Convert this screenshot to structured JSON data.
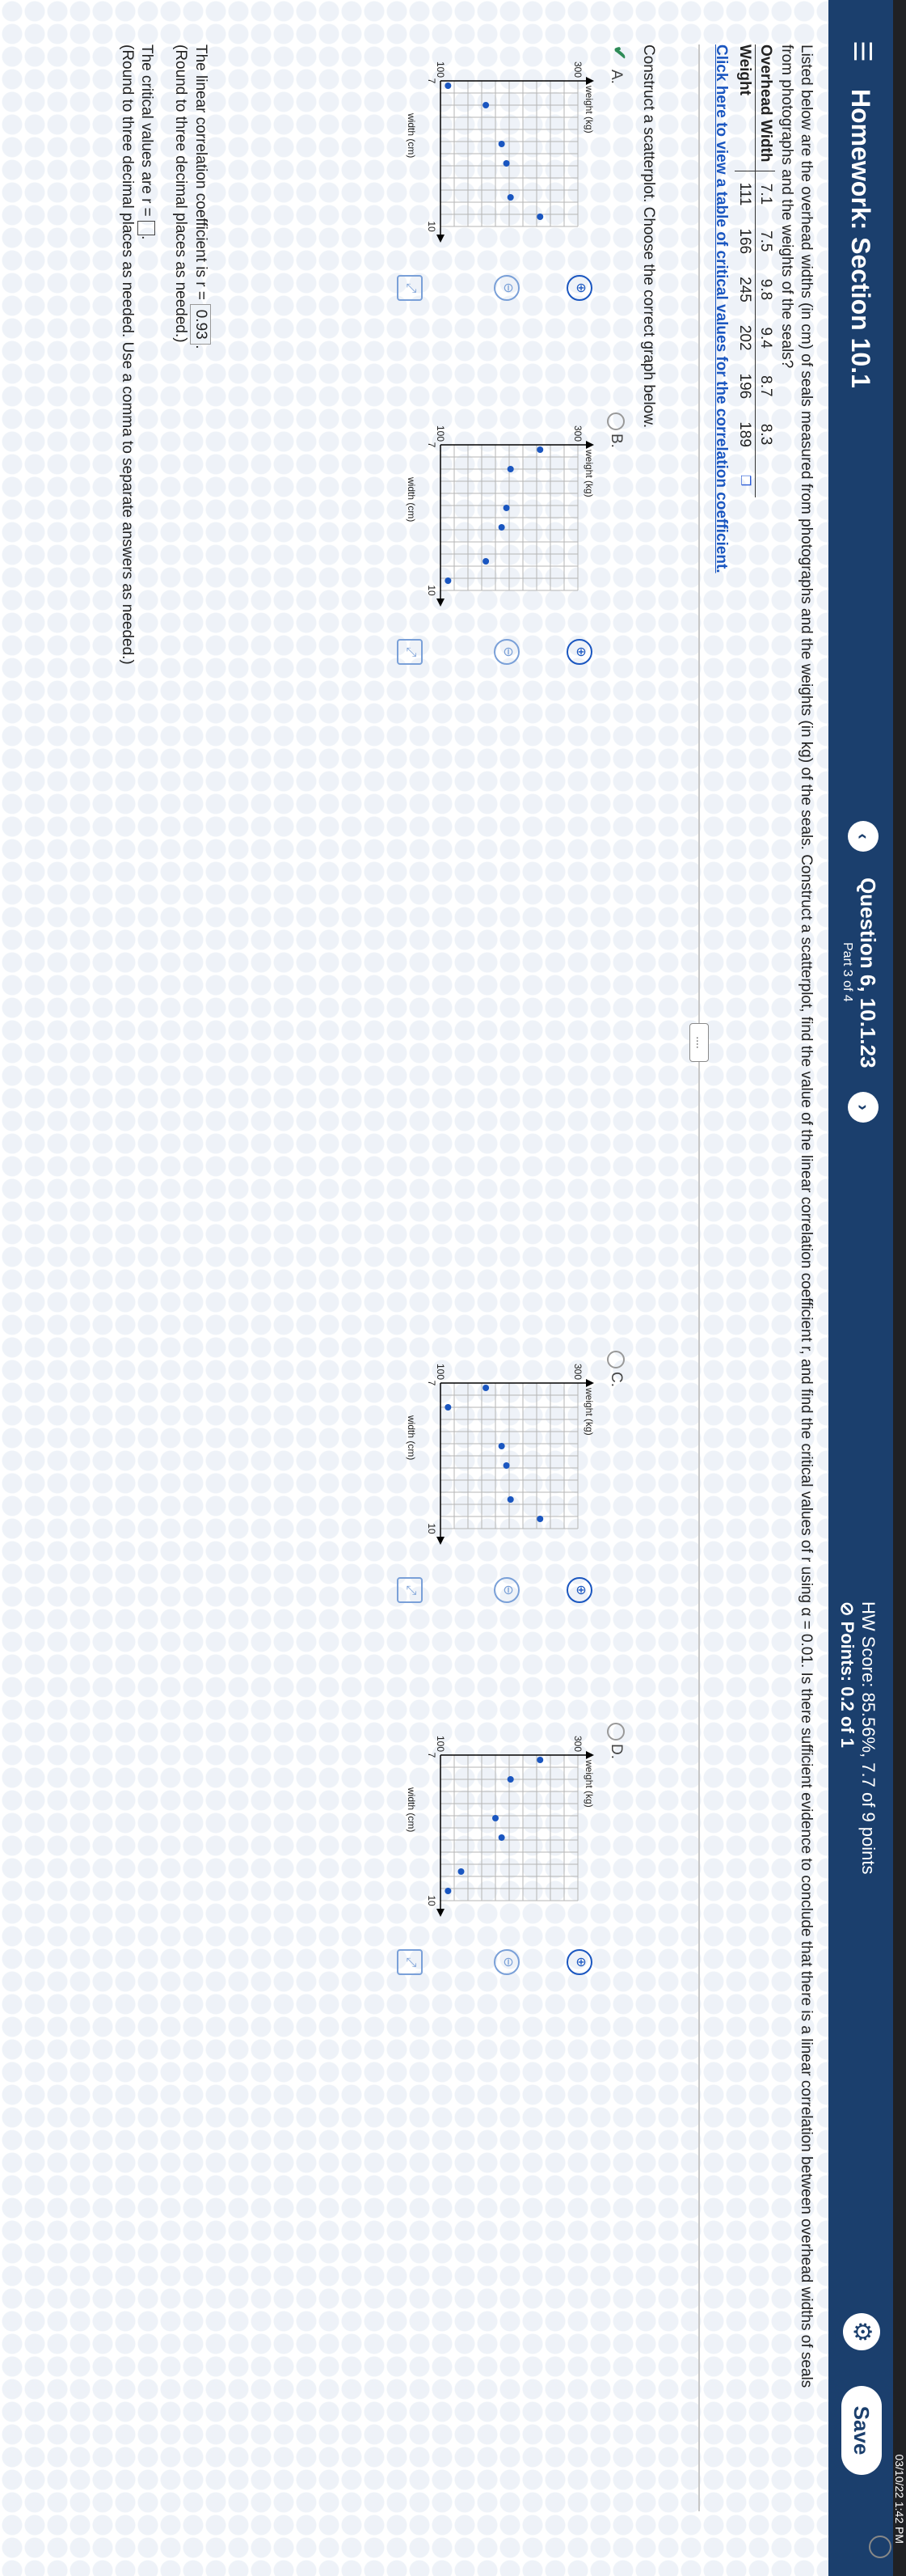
{
  "status_time": "03/10/22 1:42 PM",
  "header": {
    "menu_icon": "hamburger-icon",
    "title": "Homework: Section 10.1",
    "question_title": "Question 6, 10.1.23",
    "question_part": "Part 3 of 4",
    "hw_score": "HW Score: 85.56%, 7.7 of 9 points",
    "points": "Points: 0.2 of 1",
    "save_label": "Save"
  },
  "problem": {
    "text": "Listed below are the overhead widths (in cm) of seals measured from photographs and the weights (in kg) of the seals. Construct a scatterplot, find the value of the linear correlation coefficient r, and find the critical values of r using α = 0.01. Is there sufficient evidence to conclude that there is a linear correlation between overhead widths of seals from photographs and the weights of the seals?",
    "table": {
      "row1_label": "Overhead Width",
      "row2_label": "Weight",
      "widths": [
        "7.1",
        "7.5",
        "9.8",
        "9.4",
        "8.7",
        "8.3"
      ],
      "weights": [
        "111",
        "166",
        "245",
        "202",
        "196",
        "189"
      ]
    },
    "critical_link": "Click here to view a table of critical values for the correlation coefficient."
  },
  "more_button": "....",
  "construct_prompt": "Construct a scatterplot. Choose the correct graph below.",
  "choices": [
    {
      "letter": "A.",
      "selected": true,
      "points": [
        [
          7.1,
          111
        ],
        [
          7.5,
          166
        ],
        [
          9.8,
          245
        ],
        [
          9.4,
          202
        ],
        [
          8.7,
          196
        ],
        [
          8.3,
          189
        ]
      ]
    },
    {
      "letter": "B.",
      "selected": false,
      "points": [
        [
          7.1,
          245
        ],
        [
          7.5,
          202
        ],
        [
          9.8,
          111
        ],
        [
          9.4,
          166
        ],
        [
          8.7,
          189
        ],
        [
          8.3,
          196
        ]
      ]
    },
    {
      "letter": "C.",
      "selected": false,
      "points": [
        [
          7.1,
          166
        ],
        [
          7.5,
          111
        ],
        [
          9.8,
          245
        ],
        [
          9.4,
          202
        ],
        [
          8.7,
          196
        ],
        [
          8.3,
          189
        ]
      ]
    },
    {
      "letter": "D.",
      "selected": false,
      "points": [
        [
          7.1,
          245
        ],
        [
          7.5,
          202
        ],
        [
          9.8,
          111
        ],
        [
          9.4,
          130
        ],
        [
          8.7,
          189
        ],
        [
          8.3,
          180
        ]
      ]
    }
  ],
  "plot_labels": {
    "y_axis": "weight (kg)",
    "x_axis": "width (cm)",
    "y_top": "300",
    "y_bottom": "100",
    "x_left": "7",
    "x_right": "10"
  },
  "chart_axes": {
    "xlim": [
      7,
      10
    ],
    "ylim": [
      100,
      300
    ],
    "grid": true,
    "point_color": "#1a56c0"
  },
  "answers": {
    "r_prefix": "The linear correlation coefficient is r =",
    "r_value": "0.93",
    "r_hint": "(Round to three decimal places as needed.)",
    "crit_prefix": "The critical values are r =",
    "crit_hint": "(Round to three decimal places as needed. Use a comma to separate answers as needed.)"
  }
}
